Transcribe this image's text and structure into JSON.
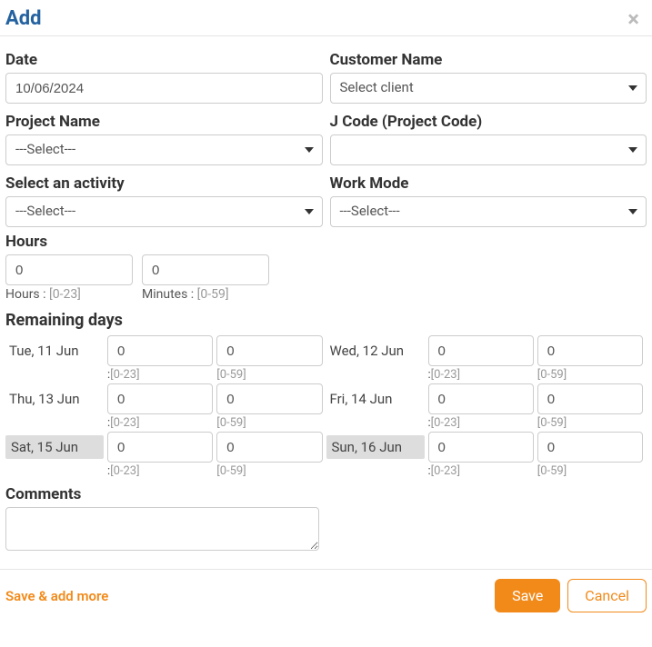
{
  "modal": {
    "title": "Add",
    "close": "×"
  },
  "fields": {
    "date": {
      "label": "Date",
      "value": "10/06/2024"
    },
    "customer": {
      "label": "Customer Name",
      "value": "Select client"
    },
    "project": {
      "label": "Project Name",
      "value": "---Select---"
    },
    "jcode": {
      "label": "J Code (Project Code)",
      "value": ""
    },
    "activity": {
      "label": "Select an activity",
      "value": "---Select---"
    },
    "workmode": {
      "label": "Work Mode",
      "value": "---Select---"
    },
    "hours": {
      "label": "Hours",
      "h": "0",
      "m": "0",
      "hHint": "Hours : ",
      "hRange": "[0-23]",
      "mHint": "Minutes : ",
      "mRange": "[0-59]"
    }
  },
  "remaining": {
    "title": "Remaining days",
    "hRangePrefix": ":",
    "hRange": "[0-23]",
    "mRange": "[0-59]",
    "days": [
      {
        "label": "Tue, 11 Jun",
        "h": "0",
        "m": "0",
        "weekend": false
      },
      {
        "label": "Wed, 12 Jun",
        "h": "0",
        "m": "0",
        "weekend": false
      },
      {
        "label": "Thu, 13 Jun",
        "h": "0",
        "m": "0",
        "weekend": false
      },
      {
        "label": "Fri, 14 Jun",
        "h": "0",
        "m": "0",
        "weekend": false
      },
      {
        "label": "Sat, 15 Jun",
        "h": "0",
        "m": "0",
        "weekend": true
      },
      {
        "label": "Sun, 16 Jun",
        "h": "0",
        "m": "0",
        "weekend": true
      }
    ]
  },
  "comments": {
    "label": "Comments",
    "value": ""
  },
  "footer": {
    "saveMore": "Save & add more",
    "save": "Save",
    "cancel": "Cancel"
  }
}
